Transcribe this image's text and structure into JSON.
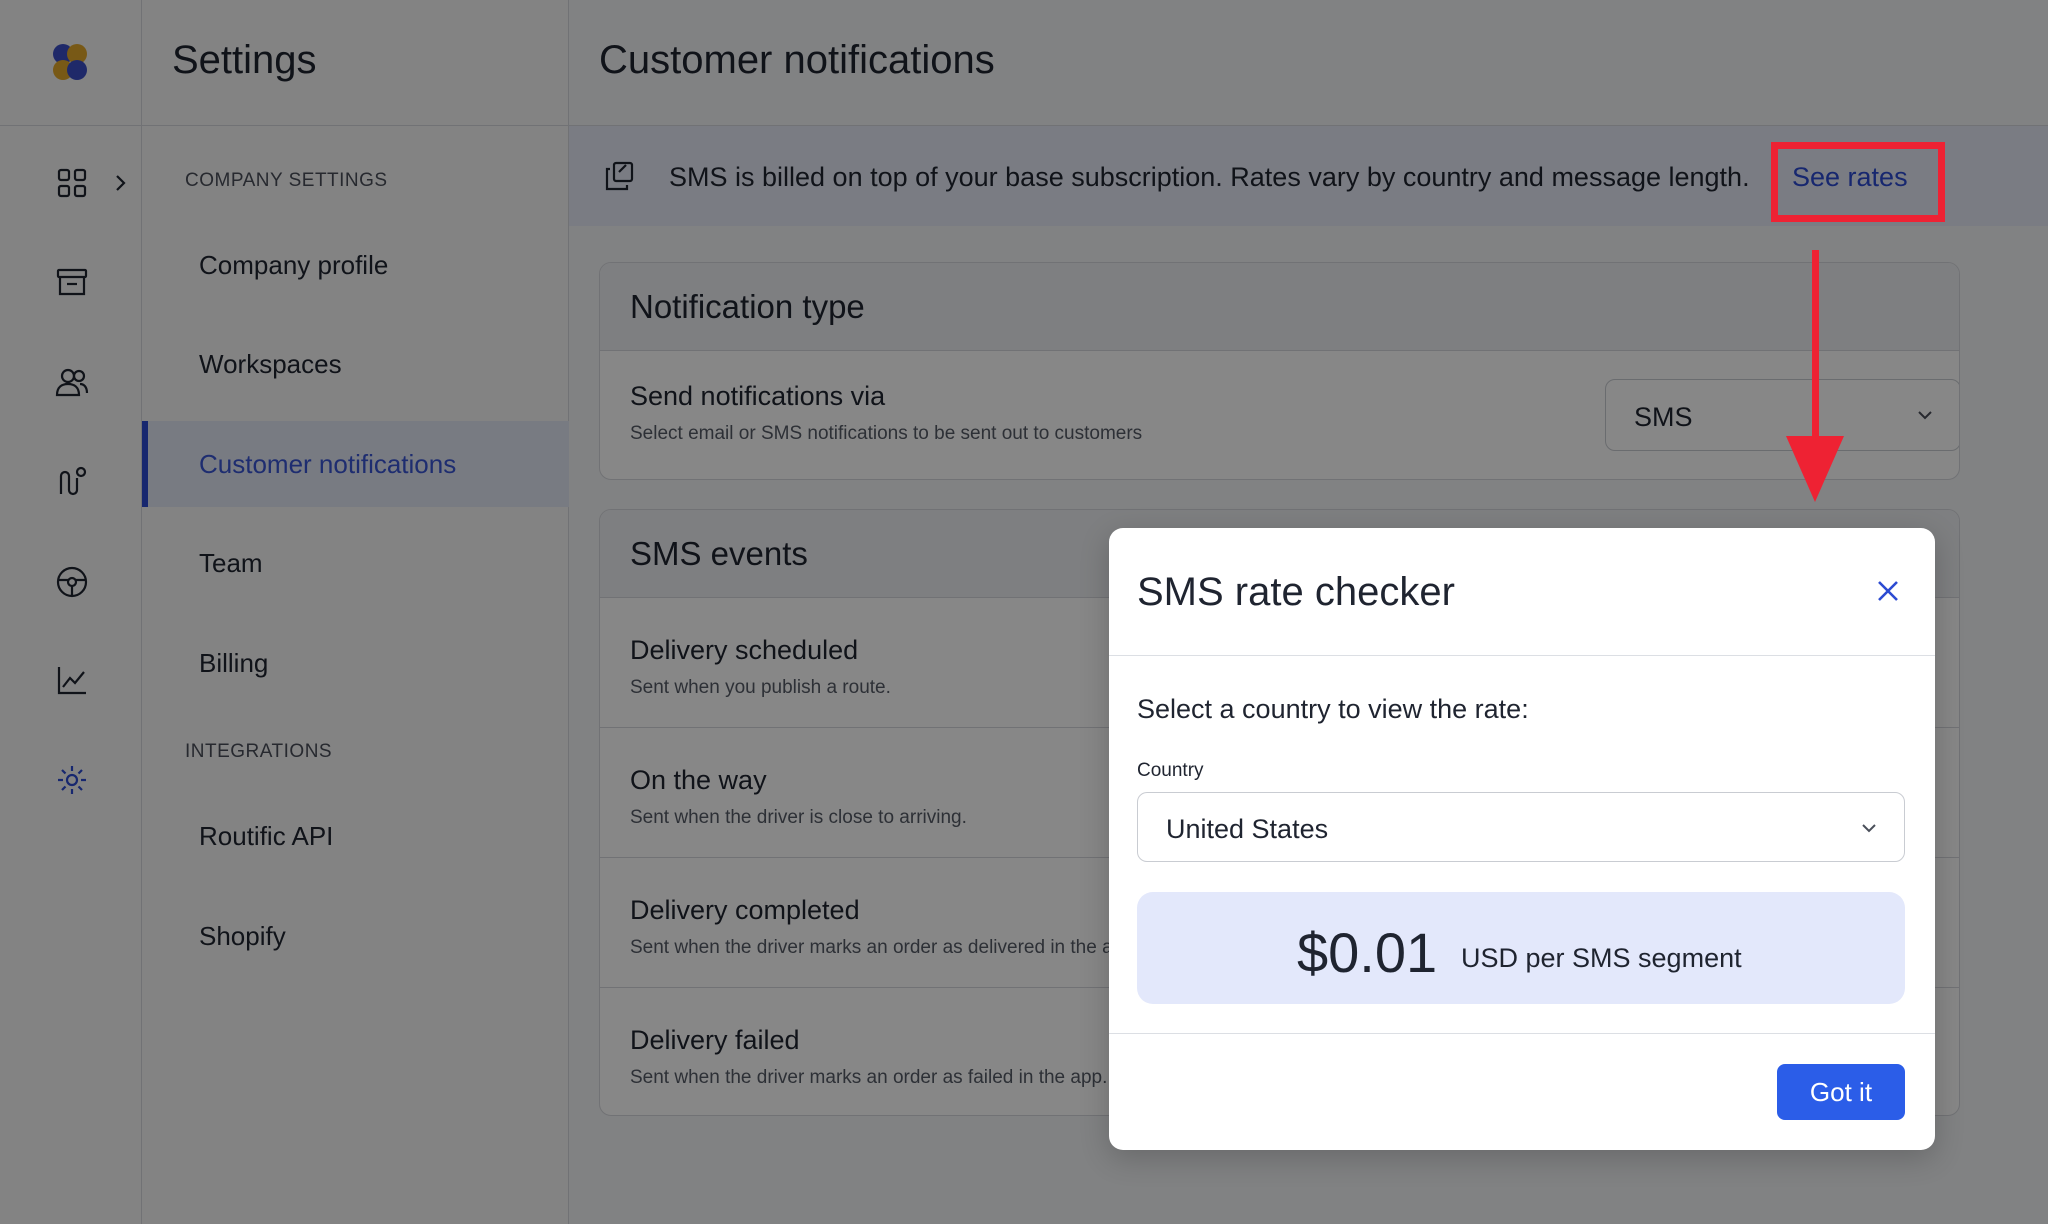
{
  "app": {
    "title": "Settings"
  },
  "rail": {
    "icons": [
      "dashboard-icon",
      "archive-icon",
      "users-icon",
      "routes-icon",
      "steering-icon",
      "analytics-icon",
      "settings-icon"
    ]
  },
  "nav": {
    "sections": [
      {
        "label": "COMPANY SETTINGS",
        "items": [
          {
            "label": "Company profile"
          },
          {
            "label": "Workspaces"
          },
          {
            "label": "Customer notifications",
            "active": true
          },
          {
            "label": "Team"
          },
          {
            "label": "Billing"
          }
        ]
      },
      {
        "label": "INTEGRATIONS",
        "items": [
          {
            "label": "Routific API"
          },
          {
            "label": "Shopify"
          }
        ]
      }
    ]
  },
  "main": {
    "title": "Customer notifications",
    "banner": {
      "text": "SMS is billed on top of your base subscription. Rates vary by country and message length.",
      "link": "See rates"
    },
    "notification_type": {
      "heading": "Notification type",
      "row_title": "Send notifications via",
      "row_sub": "Select email or SMS notifications to be sent out to customers",
      "selected": "SMS"
    },
    "sms_events": {
      "heading": "SMS events",
      "events": [
        {
          "title": "Delivery scheduled",
          "sub": "Sent when you publish a route."
        },
        {
          "title": "On the way",
          "sub": "Sent when the driver is close to arriving."
        },
        {
          "title": "Delivery completed",
          "sub": "Sent when the driver marks an order as delivered in the app."
        },
        {
          "title": "Delivery failed",
          "sub": "Sent when the driver marks an order as failed in the app."
        }
      ]
    }
  },
  "modal": {
    "title": "SMS rate checker",
    "prompt": "Select a country to view the rate:",
    "country_label": "Country",
    "country_value": "United States",
    "rate_amount": "$0.01",
    "rate_unit": "USD per SMS segment",
    "confirm_label": "Got it"
  },
  "colors": {
    "accent": "#2c4bd2",
    "highlight": "#ee2233",
    "primary_button": "#2b5de8"
  }
}
